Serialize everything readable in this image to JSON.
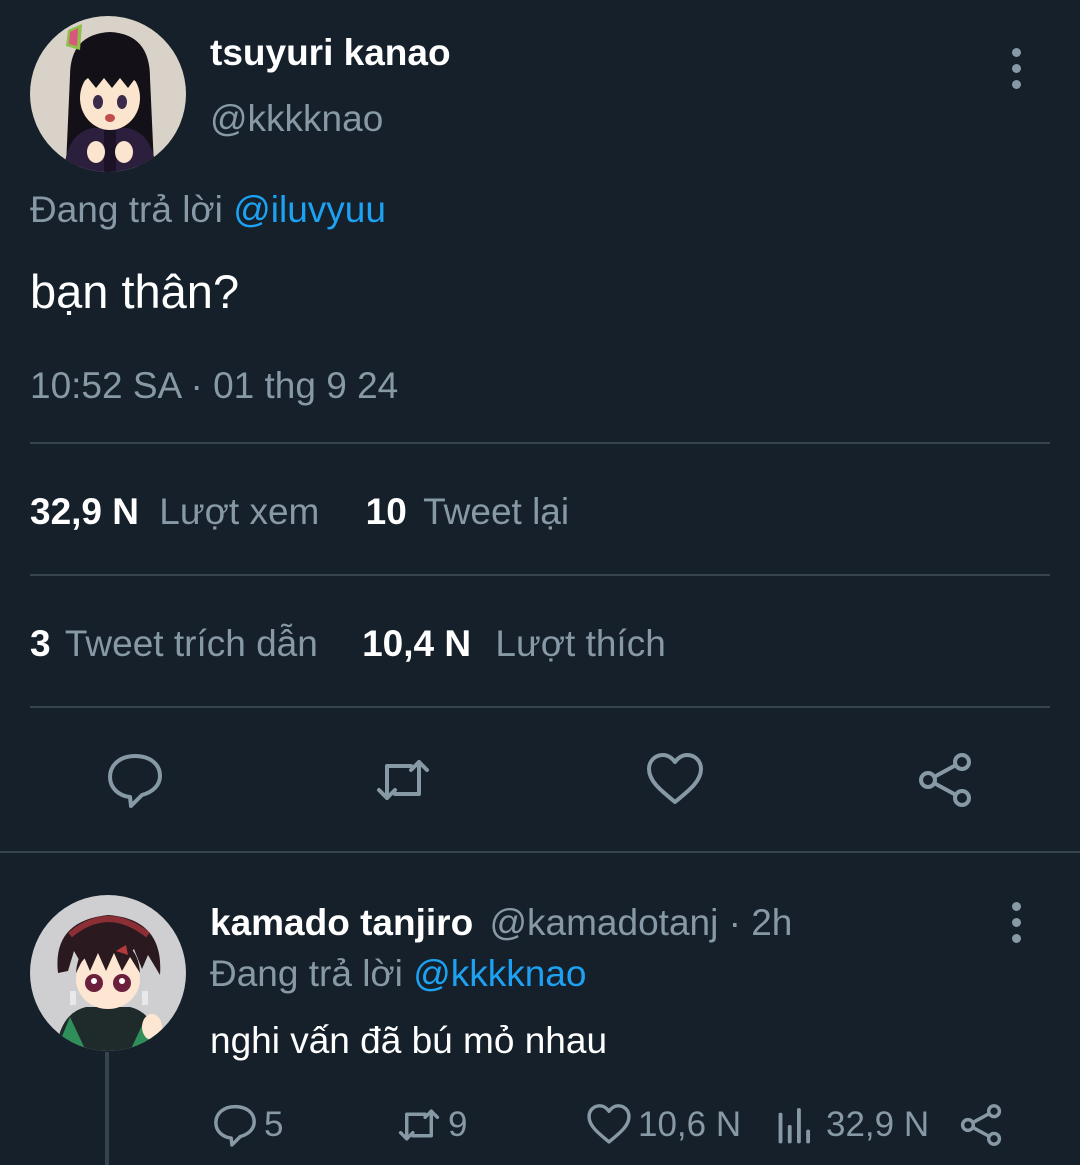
{
  "main_tweet": {
    "display_name": "tsuyuri kanao",
    "handle": "@kkkknao",
    "reply_prefix": "Đang trả lời",
    "reply_to": "@iluvyuu",
    "text": "bạn thân?",
    "timestamp": "10:52 SA · 01 thg 9 24",
    "stats": {
      "views_count": "32,9 N",
      "views_label": "Lượt xem",
      "retweets_count": "10",
      "retweets_label": "Tweet lại",
      "quotes_count": "3",
      "quotes_label": "Tweet trích dẫn",
      "likes_count": "10,4 N",
      "likes_label": "Lượt thích"
    },
    "actions": [
      "reply-icon",
      "retweet-icon",
      "like-icon",
      "share-icon"
    ]
  },
  "reply_tweet": {
    "display_name": "kamado tanjiro",
    "handle_time": "@kamadotanj · 2h",
    "reply_prefix": "Đang trả lời",
    "reply_to": "@kkkknao",
    "text": "nghi vấn đã bú mỏ nhau",
    "actions": {
      "replies": "5",
      "retweets": "9",
      "likes": "10,6 N",
      "views": "32,9 N"
    }
  },
  "colors": {
    "background": "#15202b",
    "divider": "#38444d",
    "muted": "#8899a6",
    "accent": "#1da1f2",
    "text": "#ffffff"
  }
}
